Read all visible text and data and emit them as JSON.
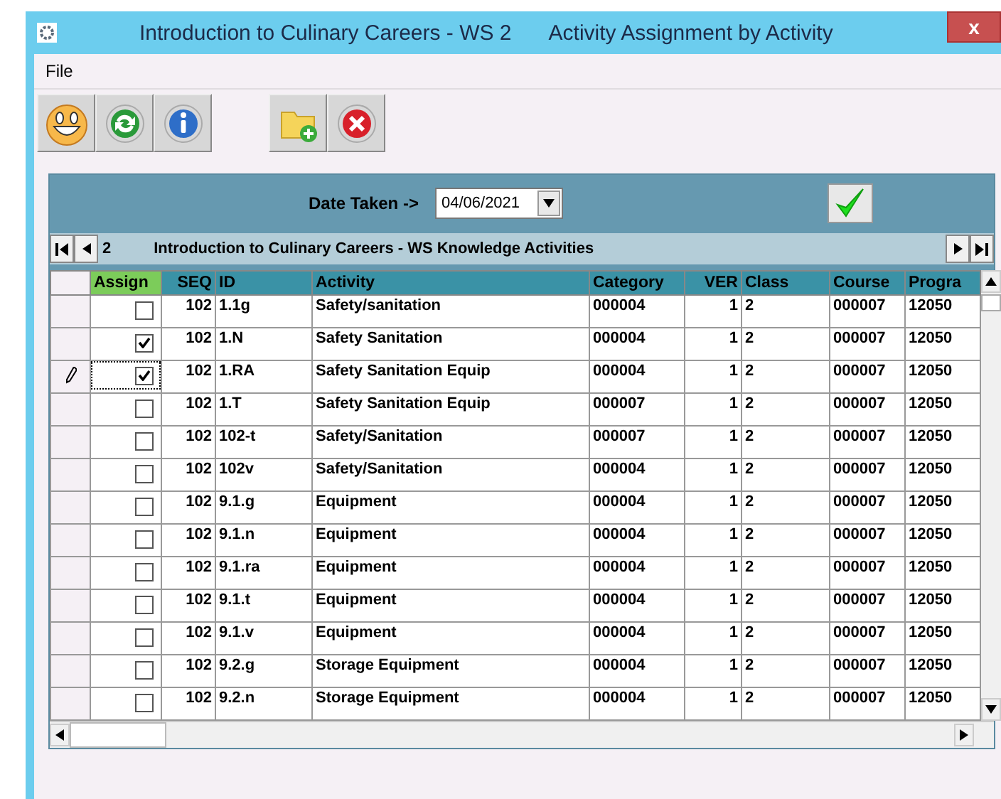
{
  "window": {
    "title": "Introduction to Culinary Careers - WS 2",
    "subtitle": "Activity Assignment by Activity",
    "close": "x"
  },
  "menu": [
    "File"
  ],
  "toolbar": [
    {
      "kind": "smiley"
    },
    {
      "kind": "refresh"
    },
    {
      "kind": "info"
    },
    {
      "kind": "gap"
    },
    {
      "kind": "folder-add"
    },
    {
      "kind": "cancel"
    }
  ],
  "date_row": {
    "label": "Date Taken ->",
    "value": "04/06/2021"
  },
  "navigator": {
    "record": "2",
    "caption": "Introduction to Culinary Careers - WS Knowledge Activities"
  },
  "table": {
    "columns": [
      {
        "label": "Assign",
        "highlight": true
      },
      {
        "label": "SEQ",
        "highlight": false
      },
      {
        "label": "ID",
        "highlight": false
      },
      {
        "label": "Activity",
        "highlight": false
      },
      {
        "label": "Category",
        "highlight": false
      },
      {
        "label": "VER",
        "highlight": false
      },
      {
        "label": "Class",
        "highlight": false
      },
      {
        "label": "Course",
        "highlight": false
      },
      {
        "label": "Progra",
        "highlight": false
      }
    ],
    "rows": [
      {
        "current": false,
        "assign": false,
        "seq": "102",
        "id": "1.1g",
        "activity": "Safety/sanitation",
        "category": "000004",
        "ver": "1",
        "class": "2",
        "course": "000007",
        "program": "12050"
      },
      {
        "current": false,
        "assign": true,
        "seq": "102",
        "id": "1.N",
        "activity": "Safety Sanitation",
        "category": "000004",
        "ver": "1",
        "class": "2",
        "course": "000007",
        "program": "12050"
      },
      {
        "current": true,
        "assign": true,
        "seq": "102",
        "id": "1.RA",
        "activity": "Safety Sanitation Equip",
        "category": "000004",
        "ver": "1",
        "class": "2",
        "course": "000007",
        "program": "12050"
      },
      {
        "current": false,
        "assign": false,
        "seq": "102",
        "id": "1.T",
        "activity": "Safety Sanitation Equip",
        "category": "000007",
        "ver": "1",
        "class": "2",
        "course": "000007",
        "program": "12050"
      },
      {
        "current": false,
        "assign": false,
        "seq": "102",
        "id": "102-t",
        "activity": "Safety/Sanitation",
        "category": "000007",
        "ver": "1",
        "class": "2",
        "course": "000007",
        "program": "12050"
      },
      {
        "current": false,
        "assign": false,
        "seq": "102",
        "id": "102v",
        "activity": "Safety/Sanitation",
        "category": "000004",
        "ver": "1",
        "class": "2",
        "course": "000007",
        "program": "12050"
      },
      {
        "current": false,
        "assign": false,
        "seq": "102",
        "id": "9.1.g",
        "activity": "Equipment",
        "category": "000004",
        "ver": "1",
        "class": "2",
        "course": "000007",
        "program": "12050"
      },
      {
        "current": false,
        "assign": false,
        "seq": "102",
        "id": "9.1.n",
        "activity": "Equipment",
        "category": "000004",
        "ver": "1",
        "class": "2",
        "course": "000007",
        "program": "12050"
      },
      {
        "current": false,
        "assign": false,
        "seq": "102",
        "id": "9.1.ra",
        "activity": "Equipment",
        "category": "000004",
        "ver": "1",
        "class": "2",
        "course": "000007",
        "program": "12050"
      },
      {
        "current": false,
        "assign": false,
        "seq": "102",
        "id": "9.1.t",
        "activity": "Equipment",
        "category": "000004",
        "ver": "1",
        "class": "2",
        "course": "000007",
        "program": "12050"
      },
      {
        "current": false,
        "assign": false,
        "seq": "102",
        "id": "9.1.v",
        "activity": "Equipment",
        "category": "000004",
        "ver": "1",
        "class": "2",
        "course": "000007",
        "program": "12050"
      },
      {
        "current": false,
        "assign": false,
        "seq": "102",
        "id": "9.2.g",
        "activity": "Storage Equipment",
        "category": "000004",
        "ver": "1",
        "class": "2",
        "course": "000007",
        "program": "12050"
      },
      {
        "current": false,
        "assign": false,
        "seq": "102",
        "id": "9.2.n",
        "activity": "Storage Equipment",
        "category": "000004",
        "ver": "1",
        "class": "2",
        "course": "000007",
        "program": "12050"
      }
    ]
  }
}
